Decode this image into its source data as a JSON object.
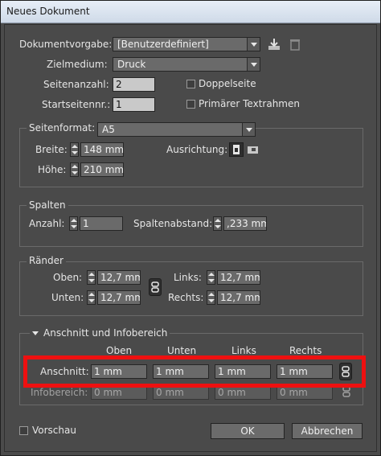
{
  "window": {
    "title": "Neues Dokument"
  },
  "document_preset": {
    "label": "Dokumentvorgabe:",
    "value": "[Benutzerdefiniert]"
  },
  "intent": {
    "label": "Zielmedium:",
    "value": "Druck"
  },
  "page_count": {
    "label": "Seitenanzahl:",
    "value": "2"
  },
  "start_page": {
    "label": "Startseitennr.:",
    "value": "1"
  },
  "facing_pages": {
    "label": "Doppelseite",
    "checked": false
  },
  "primary_text_frame": {
    "label": "Primärer Textrahmen",
    "checked": false
  },
  "page_size": {
    "label": "Seitenformat:",
    "value": "A5",
    "width_label": "Breite:",
    "width": "148 mm",
    "height_label": "Höhe:",
    "height": "210 mm",
    "orientation_label": "Ausrichtung:"
  },
  "columns": {
    "title": "Spalten",
    "number_label": "Anzahl:",
    "number": "1",
    "gutter_label": "Spaltenabstand:",
    "gutter": ",233 mm"
  },
  "margins": {
    "title": "Ränder",
    "top_label": "Oben:",
    "top": "12,7 mm",
    "bottom_label": "Unten:",
    "bottom": "12,7 mm",
    "left_label": "Links:",
    "left": "12,7 mm",
    "right_label": "Rechts:",
    "right": "12,7 mm"
  },
  "bleed_slug": {
    "title": "Anschnitt und Infobereich",
    "col_top": "Oben",
    "col_bottom": "Unten",
    "col_left": "Links",
    "col_right": "Rechts",
    "bleed_label": "Anschnitt:",
    "bleed": [
      "1 mm",
      "1 mm",
      "1 mm",
      "1 mm"
    ],
    "slug_label": "Infobereich:",
    "slug": [
      "0 mm",
      "0 mm",
      "0 mm",
      "0 mm"
    ]
  },
  "preview": {
    "label": "Vorschau",
    "checked": false
  },
  "buttons": {
    "ok": "OK",
    "cancel": "Abbrechen"
  },
  "colors": {
    "highlight": "#ee1010",
    "panel": "#4a4a4a",
    "field": "#c9c9c9"
  }
}
